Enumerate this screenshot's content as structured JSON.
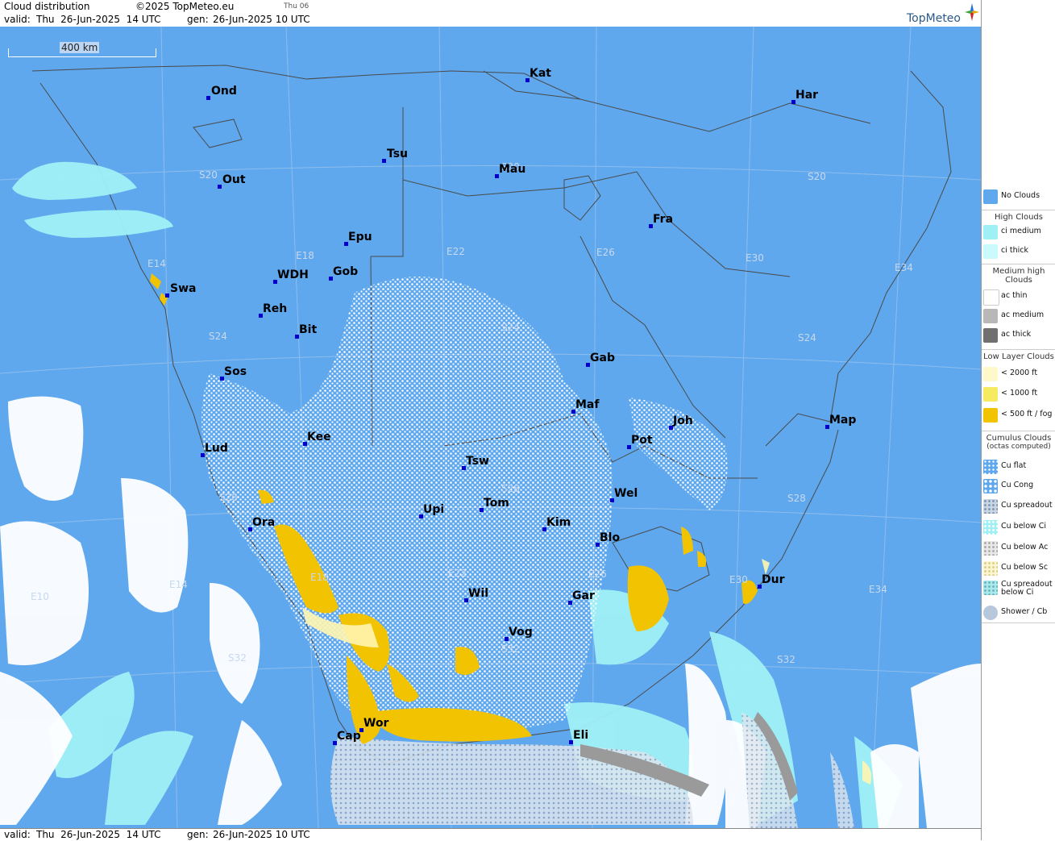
{
  "header": {
    "title": "Cloud distribution",
    "copyright": "©2025 TopMeteo.eu",
    "run_tag": "Thu 06",
    "valid_label": "valid:",
    "valid_value": "Thu  26-Jun-2025  14 UTC",
    "gen_label": "gen:",
    "gen_value": "26-Jun-2025 10 UTC",
    "logo": "TopMeteo"
  },
  "footer": {
    "valid_label": "valid:",
    "valid_value": "Thu  26-Jun-2025  14 UTC",
    "gen_label": "gen:",
    "gen_value": "26-Jun-2025 10 UTC"
  },
  "scale_bar": {
    "label": "400 km"
  },
  "cities": [
    {
      "name": "Ond"
    },
    {
      "name": "Kat"
    },
    {
      "name": "Har"
    },
    {
      "name": "Tsu"
    },
    {
      "name": "Out"
    },
    {
      "name": "Mau"
    },
    {
      "name": "Fra"
    },
    {
      "name": "Epu"
    },
    {
      "name": "WDH"
    },
    {
      "name": "Gob"
    },
    {
      "name": "Swa"
    },
    {
      "name": "Reh"
    },
    {
      "name": "Bit"
    },
    {
      "name": "Gab"
    },
    {
      "name": "Sos"
    },
    {
      "name": "Maf"
    },
    {
      "name": "Joh"
    },
    {
      "name": "Map"
    },
    {
      "name": "Kee"
    },
    {
      "name": "Pot"
    },
    {
      "name": "Lud"
    },
    {
      "name": "Tsw"
    },
    {
      "name": "Wel"
    },
    {
      "name": "Tom"
    },
    {
      "name": "Upi"
    },
    {
      "name": "Kim"
    },
    {
      "name": "Ora"
    },
    {
      "name": "Blo"
    },
    {
      "name": "Dur"
    },
    {
      "name": "Wil"
    },
    {
      "name": "Gar"
    },
    {
      "name": "Vog"
    },
    {
      "name": "Wor"
    },
    {
      "name": "Cap"
    },
    {
      "name": "Eli"
    }
  ],
  "grid_labels": {
    "lat": [
      "S20",
      "S20",
      "S20",
      "S24",
      "S24",
      "S24",
      "S28",
      "S28",
      "S28",
      "S32",
      "S32",
      "S32"
    ],
    "lon": [
      "E14",
      "E18",
      "E22",
      "E26",
      "E30",
      "E34",
      "E10",
      "E14",
      "E18",
      "E22",
      "E26",
      "E30",
      "E34"
    ]
  },
  "legend": {
    "no_clouds": "No Clouds",
    "high_title": "High Clouds",
    "high": [
      "ci medium",
      "ci thick"
    ],
    "medium_title": "Medium high Clouds",
    "medium": [
      "ac thin",
      "ac medium",
      "ac thick"
    ],
    "low_title": "Low Layer Clouds",
    "low": [
      "< 2000 ft",
      "< 1000 ft",
      "< 500 ft / fog"
    ],
    "cu_title": "Cumulus Clouds",
    "cu_subtitle": "(octas computed)",
    "cu": [
      "Cu flat",
      "Cu Cong",
      "Cu spreadout",
      "Cu below Ci",
      "Cu below Ac",
      "Cu below Sc",
      "Cu spreadout below Ci",
      "Shower / Cb"
    ]
  },
  "colors": {
    "sea_land": "#5fa8ee",
    "ci": "#9ff0f5",
    "ac": "#ffffff",
    "low": "#f2c300",
    "low_light": "#fff5b0",
    "border": "#555555"
  }
}
